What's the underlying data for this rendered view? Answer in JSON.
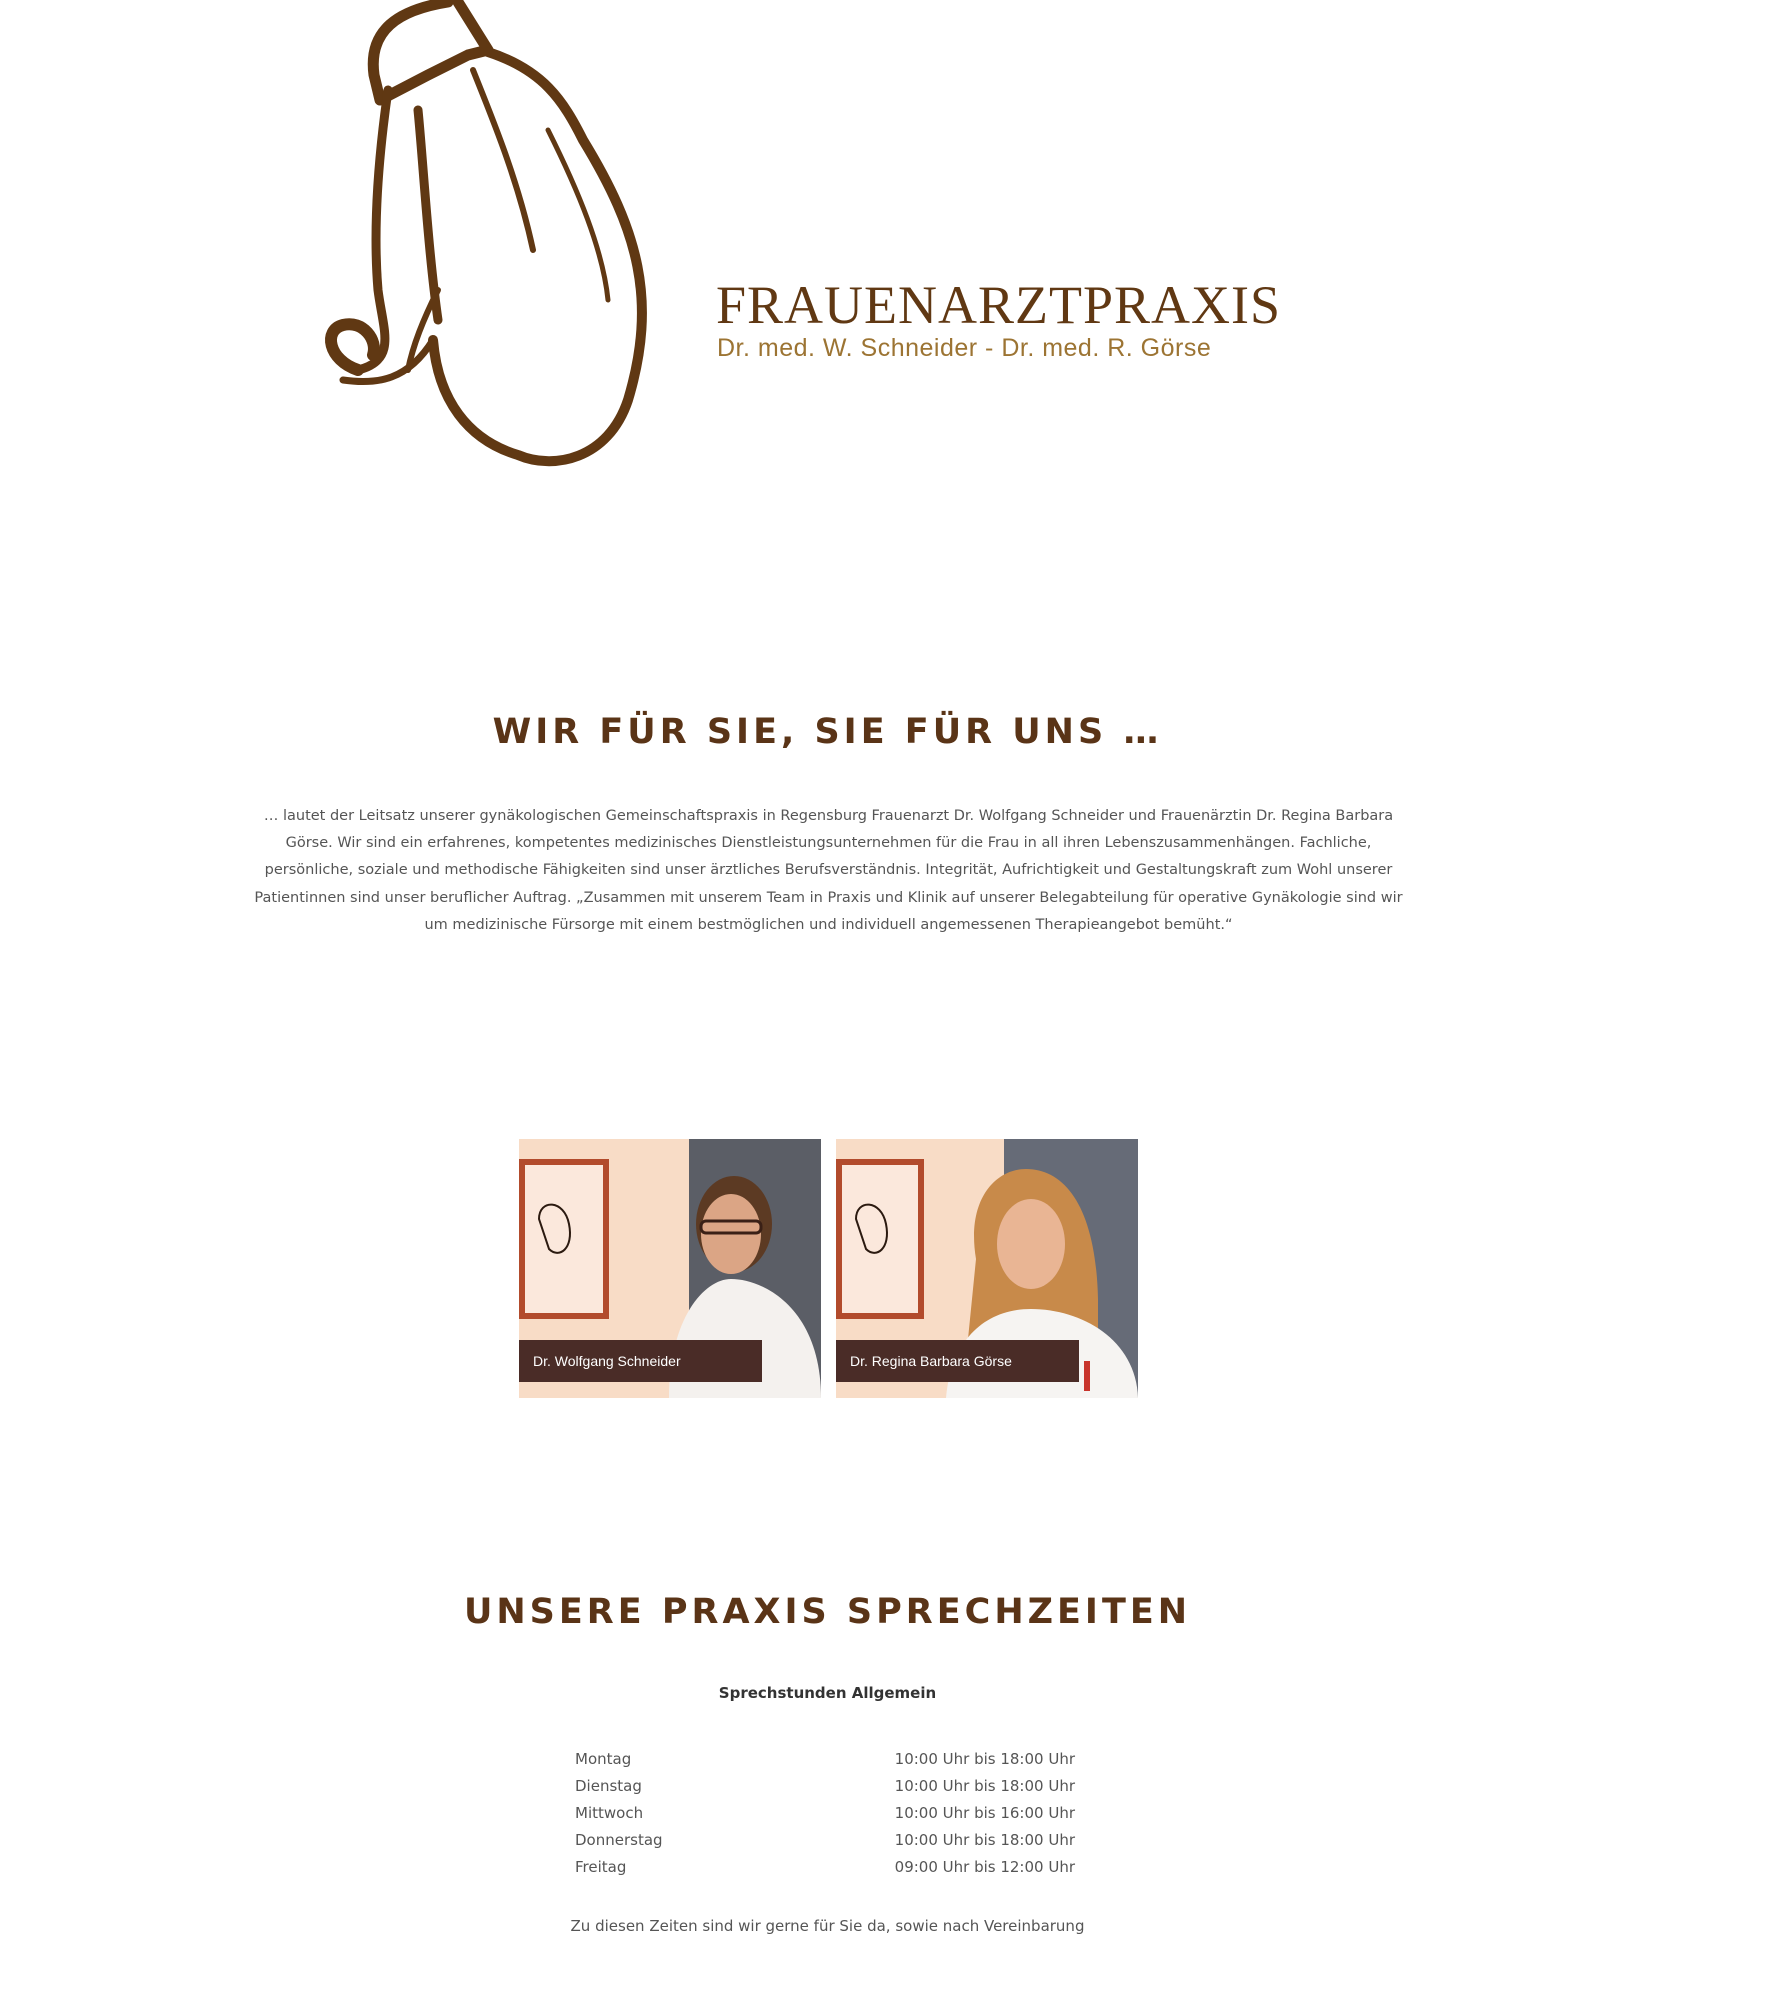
{
  "header": {
    "brand_title": "FRAUENARZTPRAXIS",
    "brand_subtitle": "Dr. med. W. Schneider - Dr. med. R. Görse",
    "logo_color": "#603813",
    "subtitle_color": "#9c7433"
  },
  "intro": {
    "title": "WIR FÜR SIE, SIE FÜR UNS …",
    "text": "… lautet der Leitsatz unserer gynäkologischen Gemeinschaftspraxis in Regensburg Frauenarzt Dr. Wolfgang Schneider und Frauenärztin Dr. Regina Barbara Görse. Wir sind ein erfahrenes, kompetentes medizinisches Dienstleistungsunternehmen für die Frau in all ihren Lebenszusammenhängen. Fachliche, persönliche, soziale und methodische Fähigkeiten sind unser ärztliches Berufsverständnis. Integrität, Aufrichtigkeit und Gestaltungskraft zum Wohl unserer Patientinnen sind unser beruflicher Auftrag. „Zusammen mit unserem Team in Praxis und Klinik auf unserer Belegabteilung für operative Gynäkologie sind wir um medizinische Fürsorge mit einem bestmöglichen und individuell angemessenen Therapieangebot bemüht.“"
  },
  "doctors": [
    {
      "name": "Dr. Wolfgang Schneider"
    },
    {
      "name": "Dr. Regina Barbara Görse"
    }
  ],
  "hours": {
    "title": "UNSERE PRAXIS SPRECHZEITEN",
    "heading": "Sprechstunden Allgemein",
    "rows": [
      {
        "day": "Montag",
        "time": "10:00 Uhr bis 18:00 Uhr"
      },
      {
        "day": "Dienstag",
        "time": "10:00 Uhr bis 18:00 Uhr"
      },
      {
        "day": "Mittwoch",
        "time": "10:00 Uhr bis 16:00 Uhr"
      },
      {
        "day": "Donnerstag",
        "time": "10:00 Uhr bis 18:00 Uhr"
      },
      {
        "day": "Freitag",
        "time": "09:00 Uhr bis 12:00 Uhr"
      }
    ],
    "note": "Zu diesen Zeiten sind wir gerne für Sie da, sowie nach Vereinbarung"
  },
  "colors": {
    "heading": "#5a3417",
    "label_background": "#4a2c27"
  }
}
